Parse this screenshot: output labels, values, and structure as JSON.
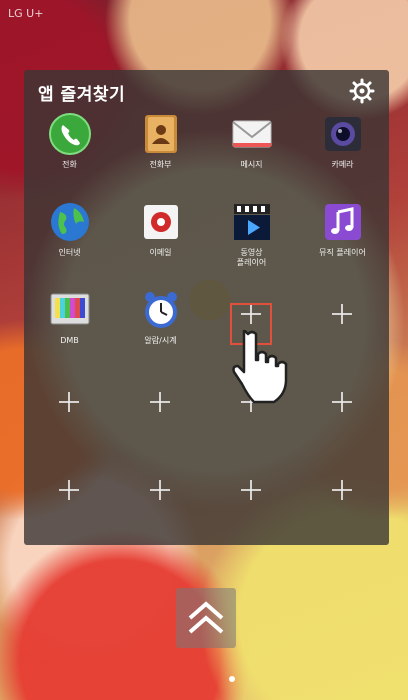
{
  "status_bar": {
    "carrier": "LG U+"
  },
  "panel": {
    "title": "앱 즐겨찾기",
    "settings_icon": "gear-icon",
    "apps": [
      {
        "label": "전화",
        "icon": "phone-icon"
      },
      {
        "label": "전화부",
        "icon": "contacts-icon"
      },
      {
        "label": "메시지",
        "icon": "message-icon"
      },
      {
        "label": "카메라",
        "icon": "camera-icon"
      },
      {
        "label": "인터넷",
        "icon": "globe-icon"
      },
      {
        "label": "이메일",
        "icon": "email-icon"
      },
      {
        "label": "동영상\n플레이어",
        "icon": "video-player-icon"
      },
      {
        "label": "뮤직 플레이어",
        "icon": "music-player-icon"
      },
      {
        "label": "DMB",
        "icon": "tv-icon"
      },
      {
        "label": "알람/시계",
        "icon": "alarm-clock-icon"
      }
    ],
    "empty_slot_icon": "plus-icon",
    "empty_slots": 10
  },
  "highlighted_slot": "add-app-slot",
  "pointer_icon": "hand-pointer-icon",
  "drawer_icon": "chevron-up-icon"
}
